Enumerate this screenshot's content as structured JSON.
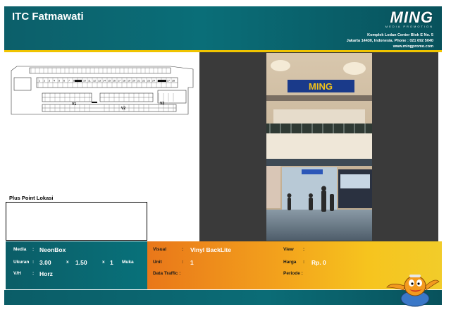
{
  "header": {
    "title": "ITC Fatmawati",
    "logo_text": "MING",
    "logo_tagline": "MEDIA PROMOTION",
    "address_line1": "Komplek Lodan Center Blok E No. 5",
    "address_line2": "Jakarta 14430, Indonesia. Phone : 021 692 5040",
    "website": "www.mingpromo.com"
  },
  "map": {
    "unit_numbers": [
      "1",
      "2",
      "3",
      "4",
      "5",
      "6",
      "7",
      "8",
      "9",
      "10",
      "11",
      "12",
      "13",
      "14",
      "15",
      "16",
      "17",
      "18",
      "19",
      "20",
      "21",
      "22",
      "23",
      "24",
      "25",
      "26",
      "27",
      "28"
    ],
    "zone_labels": [
      "V1",
      "V2",
      "V3"
    ]
  },
  "plus_point": {
    "label": "Plus Point Lokasi"
  },
  "photo": {
    "sign_text": "MING"
  },
  "info": {
    "media_label": "Media",
    "media_value": "NeonBox",
    "ukuran_label": "Ukuran",
    "width": "3.00",
    "x1": "x",
    "height": "1.50",
    "x2": "x",
    "count": "1",
    "muka": "Muka",
    "vh_label": "V/H",
    "vh_value": "Horz",
    "visual_label": "Visual",
    "visual_value": "Vinyl BackLite",
    "unit_label": "Unit",
    "unit_value": "1",
    "traffic_label": "Data Traffic :",
    "view_label": "View",
    "harga_label": "Harga",
    "harga_value": "Rp. 0",
    "periode_label": "Periode :",
    "colon": ":"
  },
  "colors": {
    "teal": "#0a6e78",
    "yellow_accent": "#f0c400",
    "orange": "#e9771a",
    "photo_bg": "#3a3a3a"
  }
}
